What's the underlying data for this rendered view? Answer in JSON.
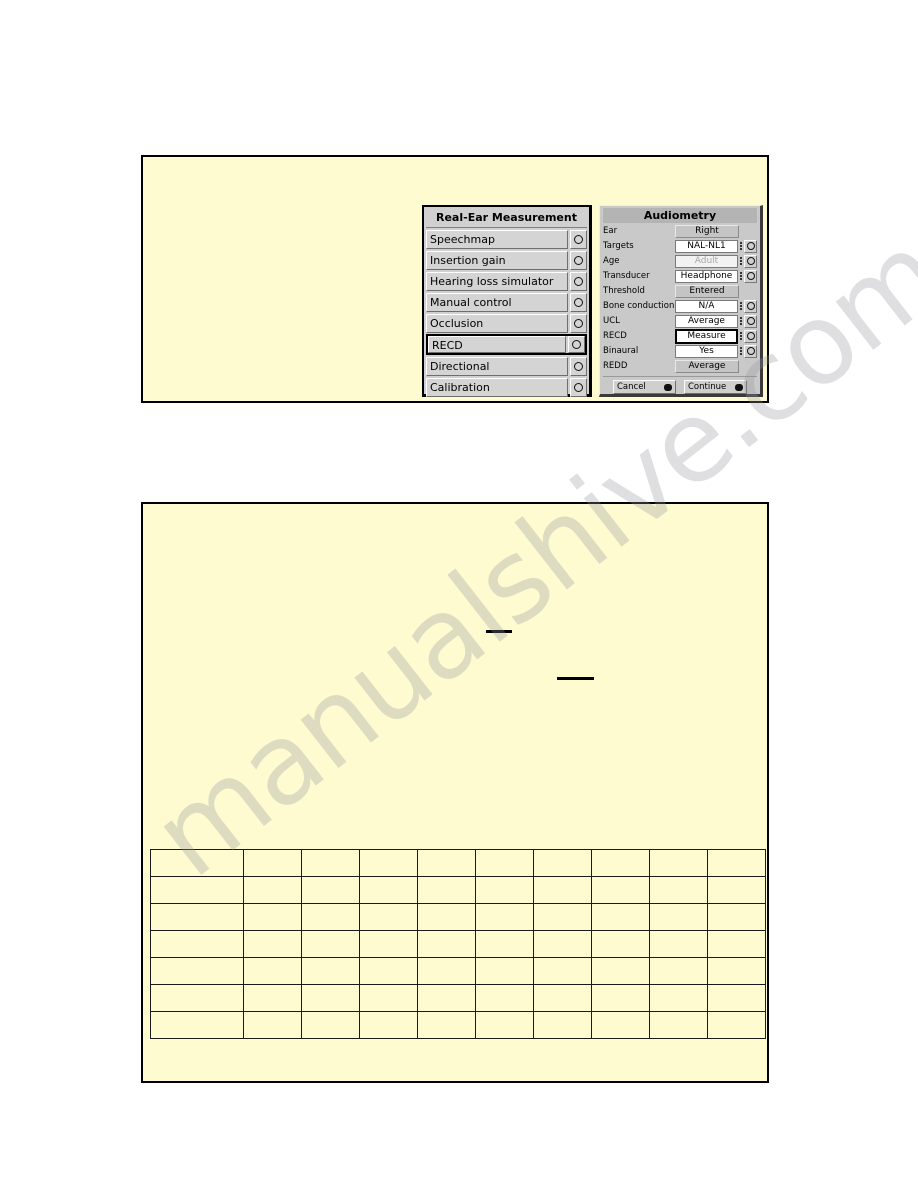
{
  "page": {
    "background_color": "#ffffff",
    "figure_background": "#fdfbcf",
    "watermark_text": "manualshive.com"
  },
  "real_ear_measurement": {
    "title": "Real-Ear Measurement",
    "items": [
      {
        "label": "Speechmap",
        "selected": false,
        "knob": "knob-icon"
      },
      {
        "label": "Insertion gain",
        "selected": false,
        "knob": "knob-icon"
      },
      {
        "label": "Hearing loss simulator",
        "selected": false,
        "knob": "knob-icon"
      },
      {
        "label": "Manual control",
        "selected": false,
        "knob": "knob-icon"
      },
      {
        "label": "Occlusion",
        "selected": false,
        "knob": "knob-icon"
      },
      {
        "label": "RECD",
        "selected": true,
        "knob": "knob-icon"
      },
      {
        "label": "Directional",
        "selected": false,
        "knob": "knob-icon"
      },
      {
        "label": "Calibration",
        "selected": false,
        "knob": "knob-icon"
      }
    ]
  },
  "audiometry": {
    "title": "Audiometry",
    "rows": [
      {
        "label": "Ear",
        "value": "Right",
        "style": "flat",
        "knob": false,
        "disabled": false,
        "selected": false
      },
      {
        "label": "Targets",
        "value": "NAL-NL1",
        "style": "field",
        "knob": true,
        "disabled": false,
        "selected": false
      },
      {
        "label": "Age",
        "value": "Adult",
        "style": "field",
        "knob": true,
        "disabled": true,
        "selected": false
      },
      {
        "label": "Transducer",
        "value": "Headphone",
        "style": "field",
        "knob": true,
        "disabled": false,
        "selected": false
      },
      {
        "label": "Threshold",
        "value": "Entered",
        "style": "flat",
        "knob": false,
        "disabled": false,
        "selected": false
      },
      {
        "label": "Bone conduction",
        "value": "N/A",
        "style": "field",
        "knob": true,
        "disabled": false,
        "selected": false
      },
      {
        "label": "UCL",
        "value": "Average",
        "style": "field",
        "knob": true,
        "disabled": false,
        "selected": false
      },
      {
        "label": "RECD",
        "value": "Measure",
        "style": "field",
        "knob": true,
        "disabled": false,
        "selected": true
      },
      {
        "label": "Binaural",
        "value": "Yes",
        "style": "field",
        "knob": true,
        "disabled": false,
        "selected": false
      },
      {
        "label": "REDD",
        "value": "Average",
        "style": "flat",
        "knob": false,
        "disabled": false,
        "selected": false
      }
    ],
    "buttons": [
      {
        "label": "Cancel",
        "indicator": "filled-dot-icon"
      },
      {
        "label": "Continue",
        "indicator": "filled-dot-icon"
      }
    ]
  },
  "bottom_figure": {
    "marks": [
      {
        "name": "blank-line-1"
      },
      {
        "name": "blank-line-2"
      }
    ],
    "grid": {
      "rows": 7,
      "columns": 10,
      "cells": [
        [
          "",
          "",
          "",
          "",
          "",
          "",
          "",
          "",
          "",
          ""
        ],
        [
          "",
          "",
          "",
          "",
          "",
          "",
          "",
          "",
          "",
          ""
        ],
        [
          "",
          "",
          "",
          "",
          "",
          "",
          "",
          "",
          "",
          ""
        ],
        [
          "",
          "",
          "",
          "",
          "",
          "",
          "",
          "",
          "",
          ""
        ],
        [
          "",
          "",
          "",
          "",
          "",
          "",
          "",
          "",
          "",
          ""
        ],
        [
          "",
          "",
          "",
          "",
          "",
          "",
          "",
          "",
          "",
          ""
        ],
        [
          "",
          "",
          "",
          "",
          "",
          "",
          "",
          "",
          "",
          ""
        ]
      ]
    }
  }
}
